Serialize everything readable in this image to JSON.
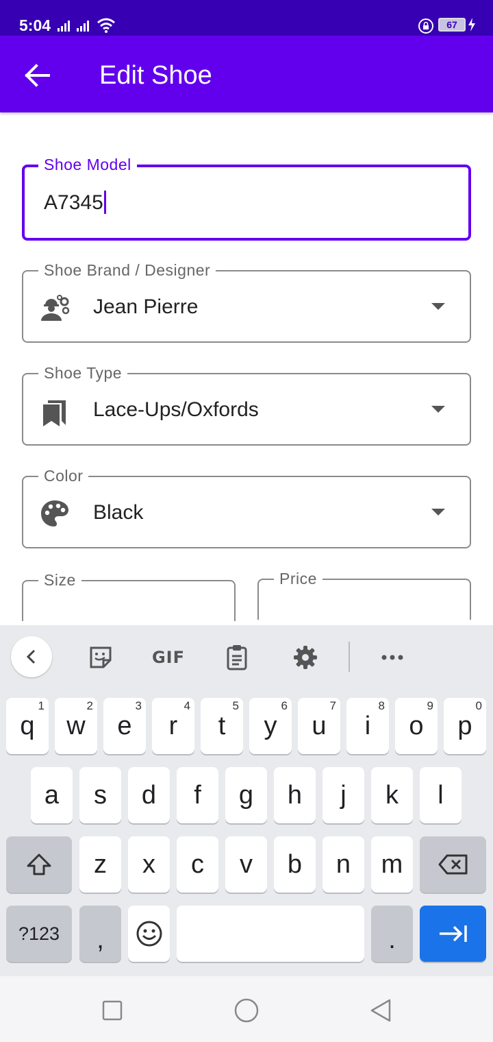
{
  "status_bar": {
    "time": "5:04",
    "battery": "67"
  },
  "app_bar": {
    "title": "Edit Shoe"
  },
  "form": {
    "shoe_model": {
      "label": "Shoe Model",
      "value": "A7345"
    },
    "brand": {
      "label": "Shoe Brand / Designer",
      "value": "Jean Pierre",
      "icon": "engineer-gears-icon"
    },
    "type": {
      "label": "Shoe Type",
      "value": "Lace-Ups/Oxfords",
      "icon": "bookmarks-icon"
    },
    "color": {
      "label": "Color",
      "value": "Black",
      "icon": "palette-icon"
    },
    "size": {
      "label": "Size"
    },
    "price": {
      "label": "Price"
    }
  },
  "keyboard": {
    "toolbar": {
      "gif_label": "GIF"
    },
    "row1": [
      {
        "key": "q",
        "hint": "1"
      },
      {
        "key": "w",
        "hint": "2"
      },
      {
        "key": "e",
        "hint": "3"
      },
      {
        "key": "r",
        "hint": "4"
      },
      {
        "key": "t",
        "hint": "5"
      },
      {
        "key": "y",
        "hint": "6"
      },
      {
        "key": "u",
        "hint": "7"
      },
      {
        "key": "i",
        "hint": "8"
      },
      {
        "key": "o",
        "hint": "9"
      },
      {
        "key": "p",
        "hint": "0"
      }
    ],
    "row2": [
      "a",
      "s",
      "d",
      "f",
      "g",
      "h",
      "j",
      "k",
      "l"
    ],
    "row3": [
      "z",
      "x",
      "c",
      "v",
      "b",
      "n",
      "m"
    ],
    "symbols_key": "?123",
    "comma_key": ",",
    "period_key": "."
  }
}
